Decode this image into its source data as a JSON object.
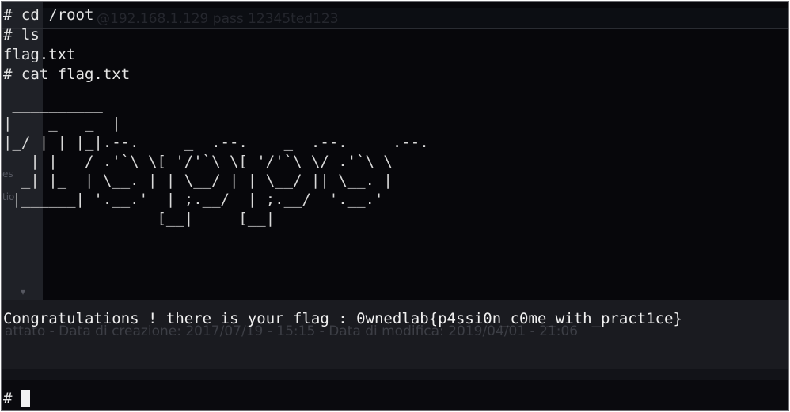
{
  "terminal": {
    "lines": [
      "# cd /root",
      "# ls",
      "flag.txt",
      "# cat flag.txt"
    ],
    "ascii_art": [
      " __________",
      "|    _   _  |",
      "|_/ | | |_|.--.     _  .--.    _  .--.     .--.",
      "   | |   / .'`\\ \\[ '/'`\\ \\[ '/'`\\ \\/ .'`\\ \\",
      "  _| |_  | \\__. | | \\__/ | | \\__/ || \\__. |",
      " |______| '.__.'  | ;.__/  | ;.__/  '.__.'",
      "                 [__|     [__|"
    ],
    "congrats": "Congratulations ! there is your flag : 0wnedlab{p4ssi0n_c0me_with_pract1ce}",
    "prompt": "#"
  },
  "background_window": {
    "url_text": "@192.168.1.129 pass 12345ted123",
    "side_label_1": "es",
    "side_label_2": "tio",
    "arrow": "▾",
    "meta_text": "attato - Data di creazione: 2017/07/19 - 15:15 - Data di modifica: 2019/04/01 - 21:06"
  },
  "colors": {
    "terminal_bg": "#07070b",
    "text": "#e6e6e6"
  }
}
